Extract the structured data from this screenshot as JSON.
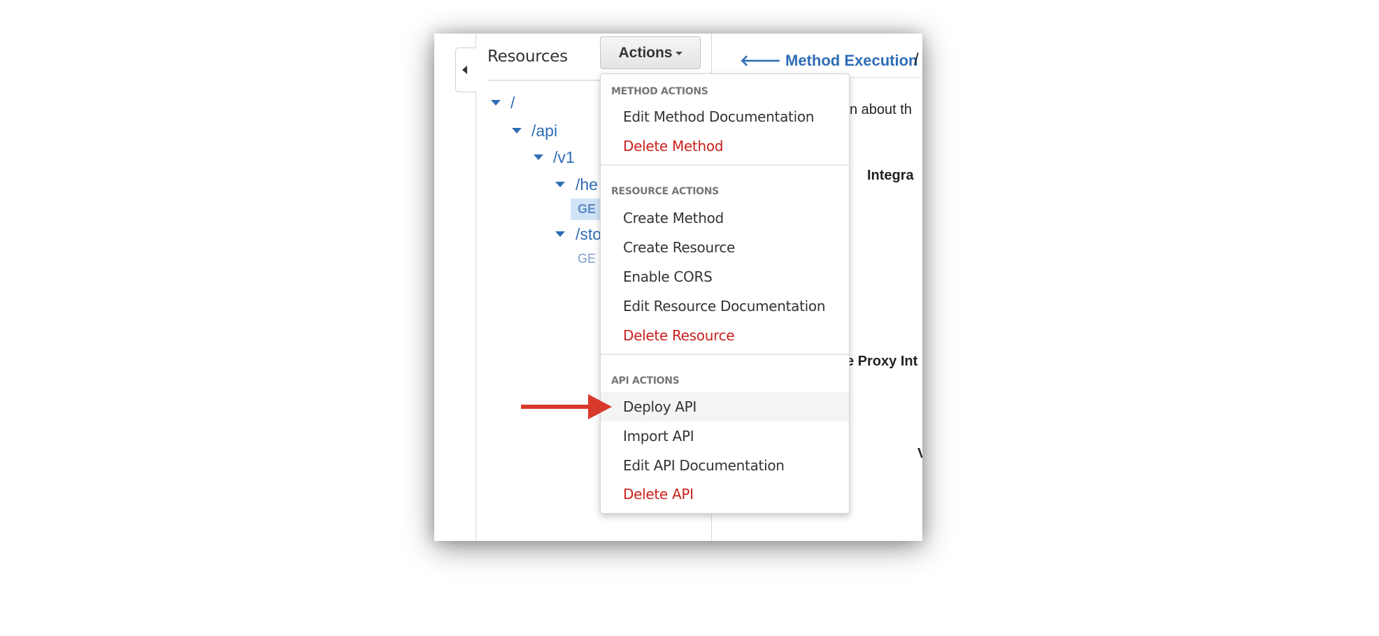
{
  "left_panel": {
    "title": "Resources",
    "actions_button": "Actions",
    "tree": [
      {
        "label": "/",
        "expanded": true
      },
      {
        "label": "/api",
        "expanded": true
      },
      {
        "label": "/v1",
        "expanded": true
      },
      {
        "label": "/he",
        "expanded": true
      },
      {
        "label": "GE",
        "method": true,
        "selected": true
      },
      {
        "label": "/sto",
        "expanded": true
      },
      {
        "label": "GE",
        "method": true,
        "selected": false
      }
    ]
  },
  "right_panel": {
    "back_link": "Method Execution",
    "breadcrumb_sep": "/",
    "text_fragments": [
      "n about th",
      "Integra",
      "e Proxy Int",
      "V"
    ]
  },
  "actions_menu": {
    "sections": [
      {
        "header": "METHOD ACTIONS",
        "items": [
          {
            "label": "Edit Method Documentation",
            "danger": false
          },
          {
            "label": "Delete Method",
            "danger": true
          }
        ]
      },
      {
        "header": "RESOURCE ACTIONS",
        "items": [
          {
            "label": "Create Method",
            "danger": false
          },
          {
            "label": "Create Resource",
            "danger": false
          },
          {
            "label": "Enable CORS",
            "danger": false
          },
          {
            "label": "Edit Resource Documentation",
            "danger": false
          },
          {
            "label": "Delete Resource",
            "danger": true
          }
        ]
      },
      {
        "header": "API ACTIONS",
        "items": [
          {
            "label": "Deploy API",
            "danger": false,
            "highlighted": true
          },
          {
            "label": "Import API",
            "danger": false
          },
          {
            "label": "Edit API Documentation",
            "danger": false
          },
          {
            "label": "Delete API",
            "danger": true
          }
        ]
      }
    ]
  },
  "colors": {
    "link_blue": "#2f6db5",
    "danger_red": "#c9211e",
    "annotation_arrow": "#d9392b",
    "selected_bg": "#d1e4f7"
  },
  "annotation": {
    "arrow_target": "Deploy API"
  }
}
